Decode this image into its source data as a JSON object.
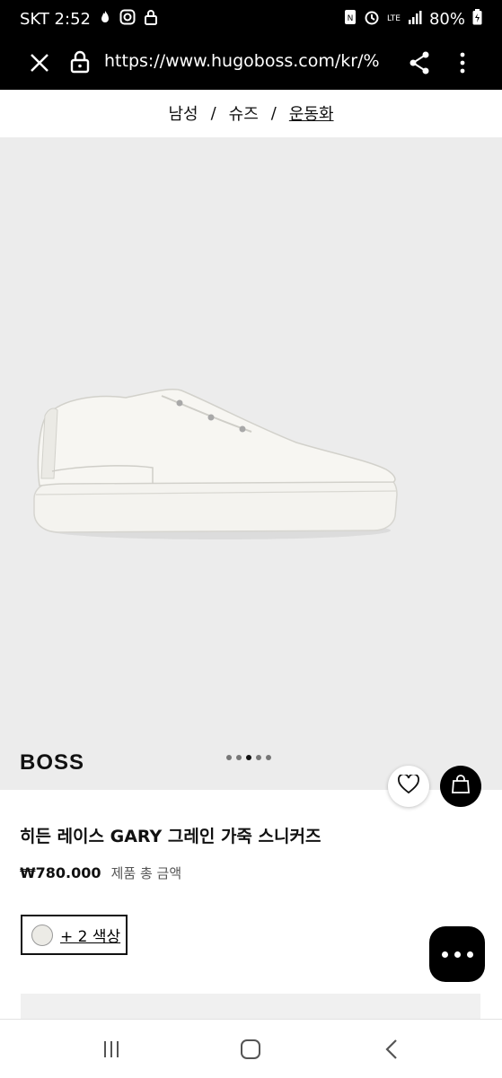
{
  "status_bar": {
    "carrier_time": "SKT 2:52",
    "network": "LTE",
    "battery": "80%",
    "icons": [
      "notification-icon",
      "instagram-icon",
      "lock-icon",
      "nfc-icon",
      "alarm-icon",
      "signal-icon",
      "battery-icon"
    ]
  },
  "browser": {
    "url": "https://www.hugoboss.com/kr/%",
    "icons": [
      "close-icon",
      "lock-icon",
      "share-icon",
      "menu-icon"
    ]
  },
  "breadcrumb": {
    "items": [
      "남성",
      "슈즈",
      "운동화"
    ],
    "separator": "/"
  },
  "gallery": {
    "brand": "BOSS",
    "dots_total": 5,
    "dots_active_index": 2,
    "background": "#ececec"
  },
  "product": {
    "title": "히든 레이스 GARY 그레인 가죽 스니커즈",
    "price": "₩780.000",
    "price_note": "제품 총 금액",
    "color_more": "+ 2 색상"
  },
  "actions": {
    "favorite_icon": "heart-icon",
    "bag_icon": "shopping-bag-icon",
    "chat_icon": "chat-icon"
  },
  "colors": {
    "status_bg": "#000000",
    "gallery_bg": "#ececec",
    "accent": "#000000"
  }
}
